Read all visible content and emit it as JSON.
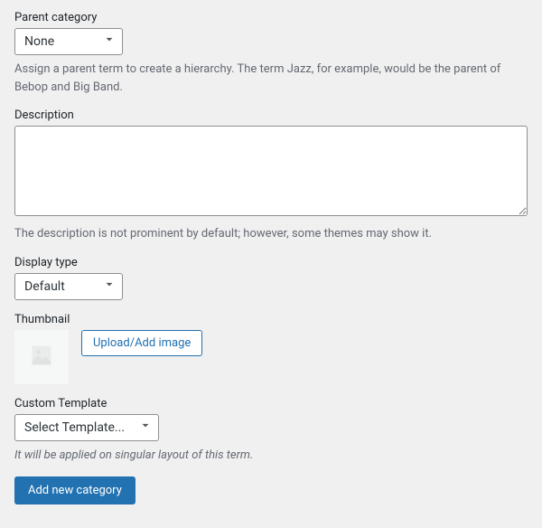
{
  "parent": {
    "label": "Parent category",
    "selected": "None",
    "help": "Assign a parent term to create a hierarchy. The term Jazz, for example, would be the parent of Bebop and Big Band."
  },
  "description": {
    "label": "Description",
    "value": "",
    "help": "The description is not prominent by default; however, some themes may show it."
  },
  "display_type": {
    "label": "Display type",
    "selected": "Default"
  },
  "thumbnail": {
    "label": "Thumbnail",
    "upload_button": "Upload/Add image"
  },
  "custom_template": {
    "label": "Custom Template",
    "selected": "Select Template...",
    "help": "It will be applied on singular layout of this term."
  },
  "submit": {
    "label": "Add new category"
  }
}
